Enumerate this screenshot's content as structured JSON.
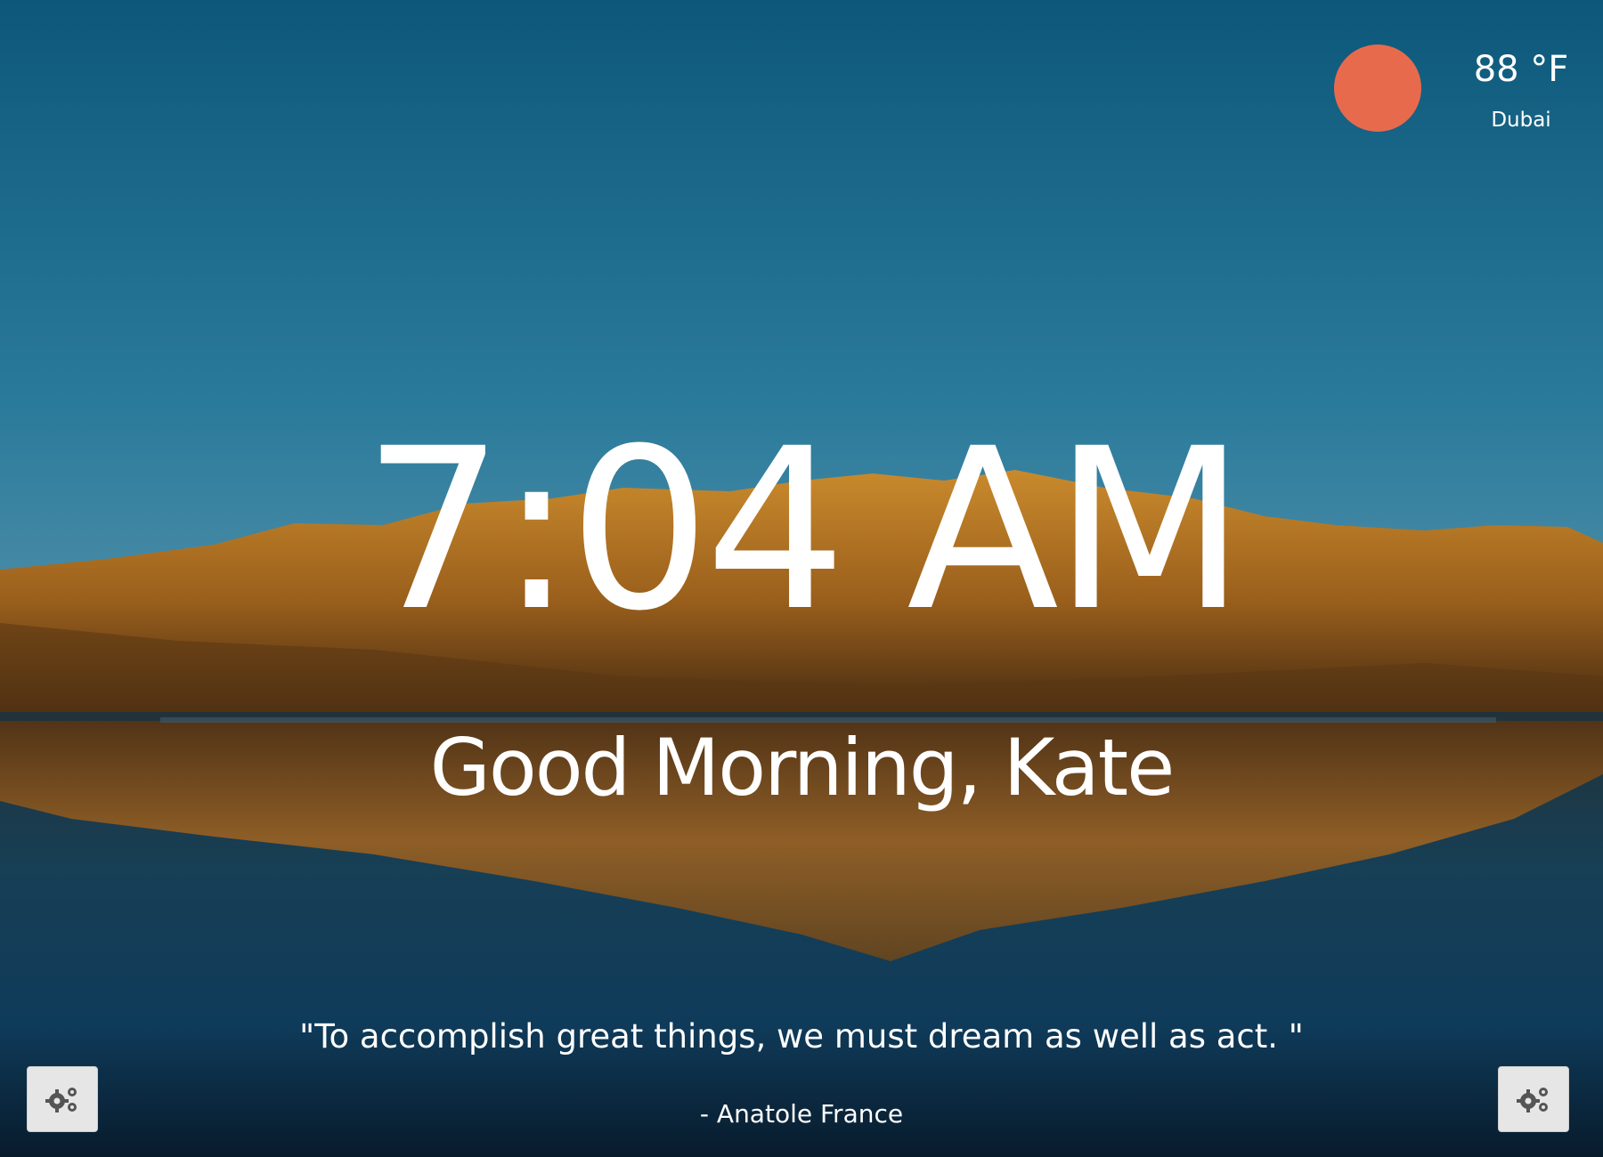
{
  "weather": {
    "icon": "sun-icon",
    "sun_color": "#e86a4d",
    "temperature": "88 °F",
    "city": "Dubai"
  },
  "clock": {
    "time": "7:04 AM"
  },
  "greeting": {
    "text": "Good Morning, Kate"
  },
  "quote": {
    "text": "\"To accomplish great things, we must dream as well as act. \"",
    "author": "- Anatole France"
  },
  "controls": {
    "left_icon": "gears-icon",
    "right_icon": "gears-icon"
  }
}
